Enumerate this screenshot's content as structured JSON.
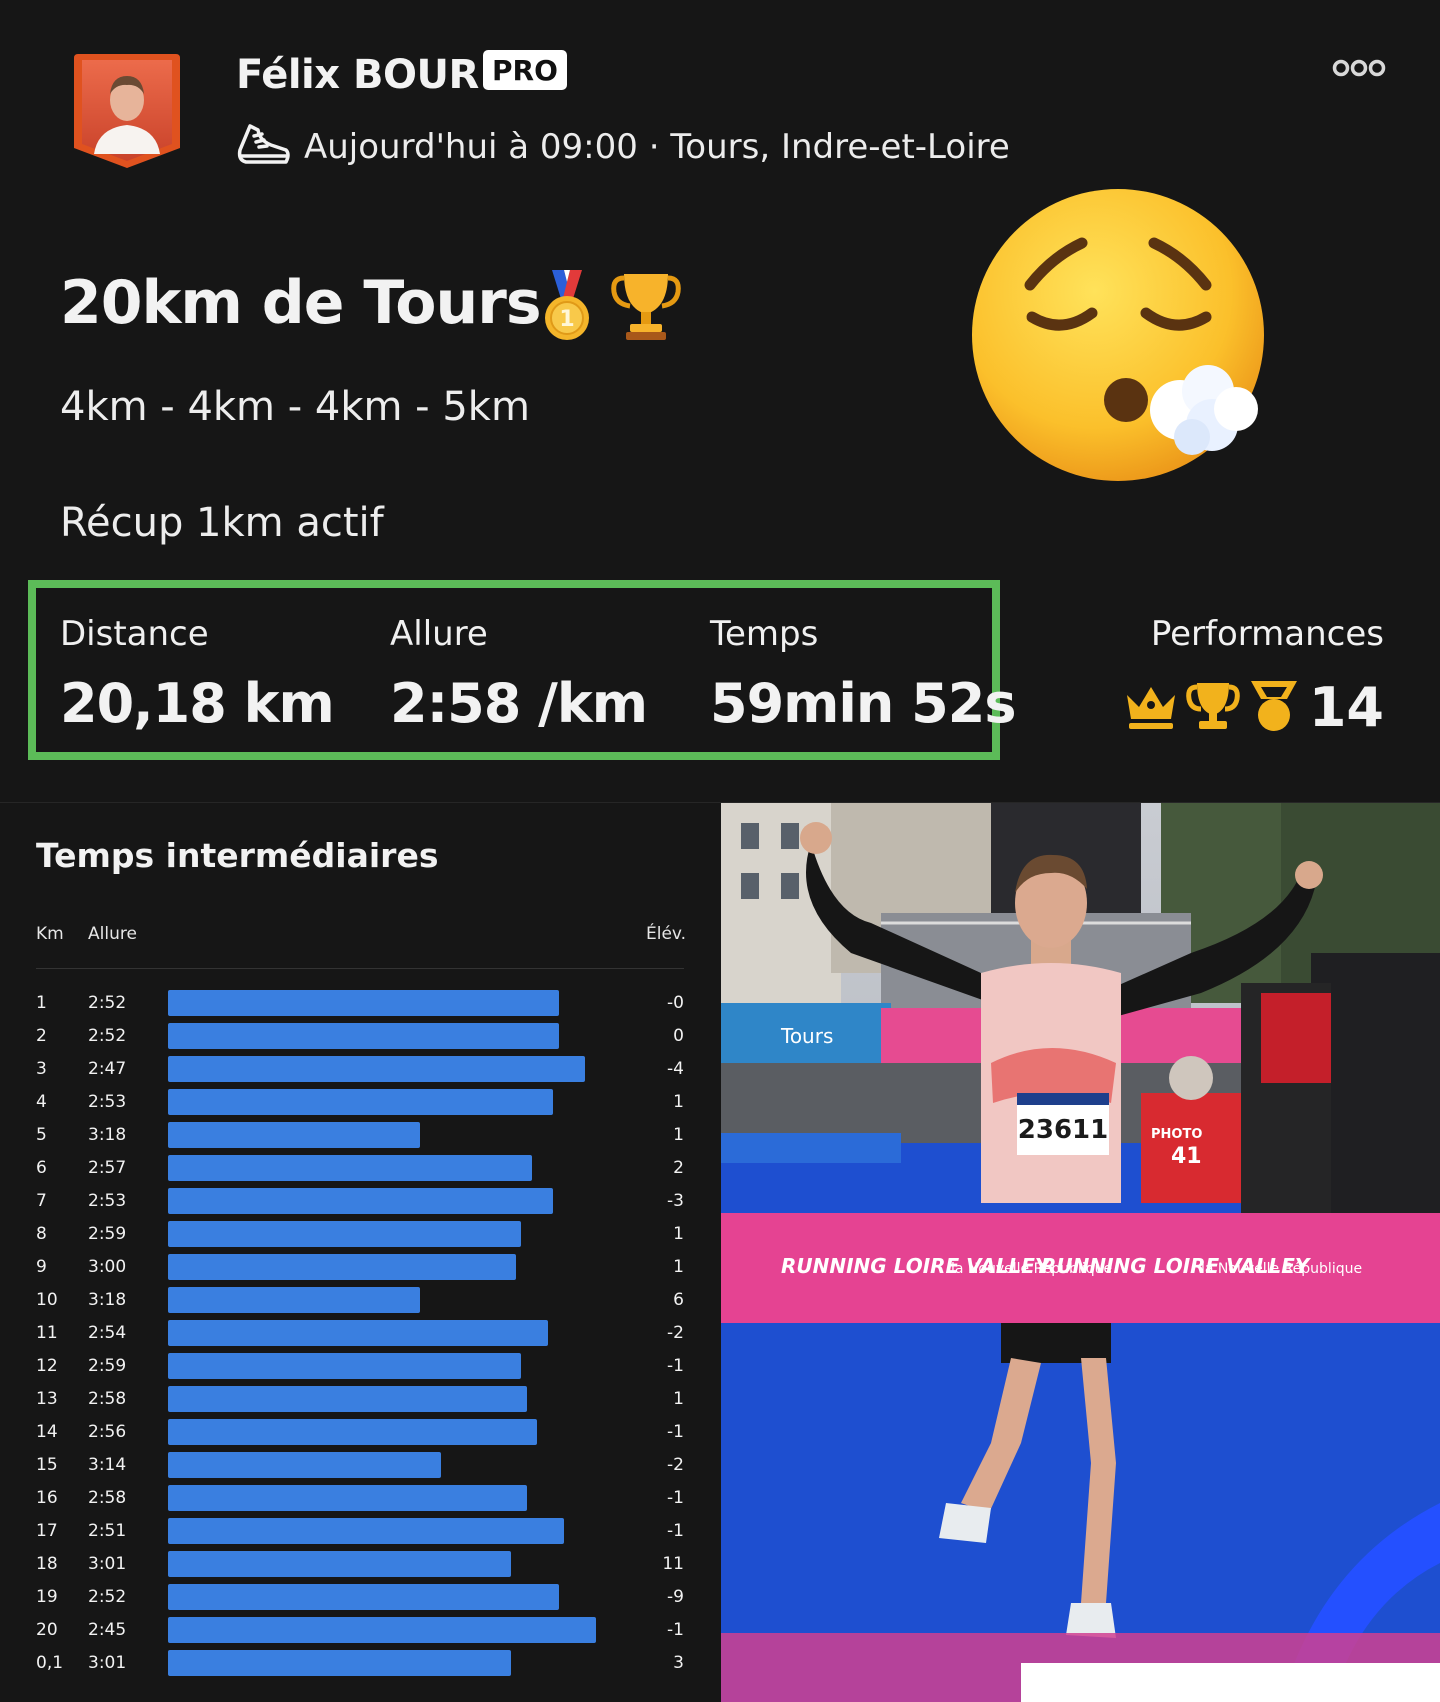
{
  "header": {
    "athlete_name": "Félix BOUR",
    "badge": "PRO",
    "activity_meta": "Aujourd'hui à 09:00 · Tours, Indre-et-Loire",
    "more_icon": "more-dots-icon"
  },
  "activity": {
    "title": "20km de Tours",
    "emojis": [
      "first-place-medal-icon",
      "trophy-icon"
    ],
    "description_line1": "4km - 4km - 4km - 5km",
    "description_line2": "Récup 1km actif",
    "mood_emoji": "exhaling-face-icon"
  },
  "stats": {
    "distance_label": "Distance",
    "distance_value": "20,18 km",
    "pace_label": "Allure",
    "pace_value": "2:58 /km",
    "time_label": "Temps",
    "time_value": "59min 52s",
    "highlight_color": "#5cbb58"
  },
  "performances": {
    "label": "Performances",
    "icons": [
      "crown-icon",
      "trophy-icon",
      "medal-icon"
    ],
    "count": "14",
    "icon_color": "#f2b21c"
  },
  "splits": {
    "title": "Temps intermédiaires",
    "col_km": "Km",
    "col_pace": "Allure",
    "col_elev": "Élév.",
    "bar_color": "#3a7fe0",
    "rows": [
      {
        "km": "1",
        "pace": "2:52",
        "elev": "-0"
      },
      {
        "km": "2",
        "pace": "2:52",
        "elev": "0"
      },
      {
        "km": "3",
        "pace": "2:47",
        "elev": "-4"
      },
      {
        "km": "4",
        "pace": "2:53",
        "elev": "1"
      },
      {
        "km": "5",
        "pace": "3:18",
        "elev": "1"
      },
      {
        "km": "6",
        "pace": "2:57",
        "elev": "2"
      },
      {
        "km": "7",
        "pace": "2:53",
        "elev": "-3"
      },
      {
        "km": "8",
        "pace": "2:59",
        "elev": "1"
      },
      {
        "km": "9",
        "pace": "3:00",
        "elev": "1"
      },
      {
        "km": "10",
        "pace": "3:18",
        "elev": "6"
      },
      {
        "km": "11",
        "pace": "2:54",
        "elev": "-2"
      },
      {
        "km": "12",
        "pace": "2:59",
        "elev": "-1"
      },
      {
        "km": "13",
        "pace": "2:58",
        "elev": "1"
      },
      {
        "km": "14",
        "pace": "2:56",
        "elev": "-1"
      },
      {
        "km": "15",
        "pace": "3:14",
        "elev": "-2"
      },
      {
        "km": "16",
        "pace": "2:58",
        "elev": "-1"
      },
      {
        "km": "17",
        "pace": "2:51",
        "elev": "-1"
      },
      {
        "km": "18",
        "pace": "3:01",
        "elev": "11"
      },
      {
        "km": "19",
        "pace": "2:52",
        "elev": "-9"
      },
      {
        "km": "20",
        "pace": "2:45",
        "elev": "-1"
      },
      {
        "km": "0,1",
        "pace": "3:01",
        "elev": "3"
      }
    ]
  },
  "photo": {
    "bib_number": "23611",
    "photographer_bib": "41",
    "banner_brand": "RUNNING LOIRE VALLEY",
    "banner_sponsor": "la Nouvelle République",
    "city_sign": "Tours",
    "press_label": "PHOTO"
  }
}
